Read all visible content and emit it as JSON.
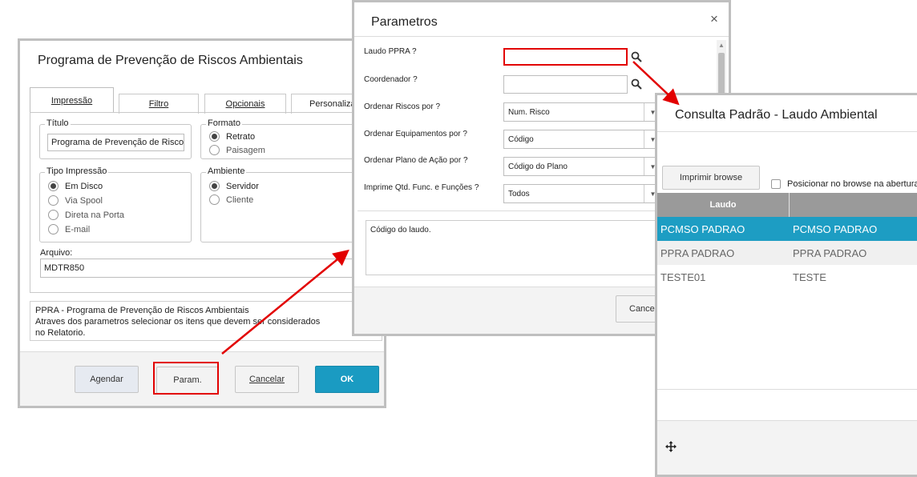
{
  "main_dialog": {
    "title": "Programa de Prevenção de Riscos Ambientais",
    "tabs": [
      "Impressão",
      "Filtro",
      "Opcionais",
      "Personaliza"
    ],
    "titulo_label": "Título",
    "titulo_value": "Programa de Prevenção de Risco",
    "formato_label": "Formato",
    "formato_options": [
      "Retrato",
      "Paisagem"
    ],
    "tipo_label": "Tipo Impressão",
    "tipo_options": [
      "Em Disco",
      "Via Spool",
      "Direta na Porta",
      "E-mail"
    ],
    "ambiente_label": "Ambiente",
    "ambiente_options": [
      "Servidor",
      "Cliente"
    ],
    "arquivo_label": "Arquivo:",
    "arquivo_value": "MDTR850",
    "description_lines": [
      "PPRA - Programa de Prevenção de Riscos Ambientais",
      "Atraves dos parametros selecionar os itens que devem ser considerados",
      "no Relatorio."
    ],
    "buttons": {
      "agendar": "Agendar",
      "param": "Param.",
      "cancelar": "Cancelar",
      "ok": "OK"
    }
  },
  "param_dialog": {
    "title": "Parametros",
    "close": "×",
    "fields": [
      {
        "label": "Laudo PPRA ?",
        "value": ""
      },
      {
        "label": "Coordenador ?",
        "value": ""
      },
      {
        "label": "Ordenar Riscos por ?",
        "value": "Num. Risco"
      },
      {
        "label": "Ordenar Equipamentos por ?",
        "value": "Código"
      },
      {
        "label": "Ordenar Plano de Ação por ?",
        "value": "Código do Plano"
      },
      {
        "label": "Imprime Qtd. Func. e Funções ?",
        "value": "Todos"
      }
    ],
    "help_text": "Código do laudo.",
    "cancel_label": "Cancela"
  },
  "consulta_dialog": {
    "title": "Consulta Padrão - Laudo Ambiental",
    "print_button": "Imprimir browse",
    "position_checkbox": "Posicionar no browse na abertura",
    "column_header": "Laudo",
    "rows": [
      {
        "c1": "PCMSO PADRAO",
        "c2": "PCMSO PADRAO"
      },
      {
        "c1": "PPRA PADRAO",
        "c2": "PPRA PADRAO"
      },
      {
        "c1": "TESTE01",
        "c2": "TESTE"
      }
    ]
  },
  "colors": {
    "accent": "#1a9bc2",
    "selected_row": "#1d9dc3",
    "header_gray": "#9a9a9a",
    "highlight_red": "#e20000"
  }
}
